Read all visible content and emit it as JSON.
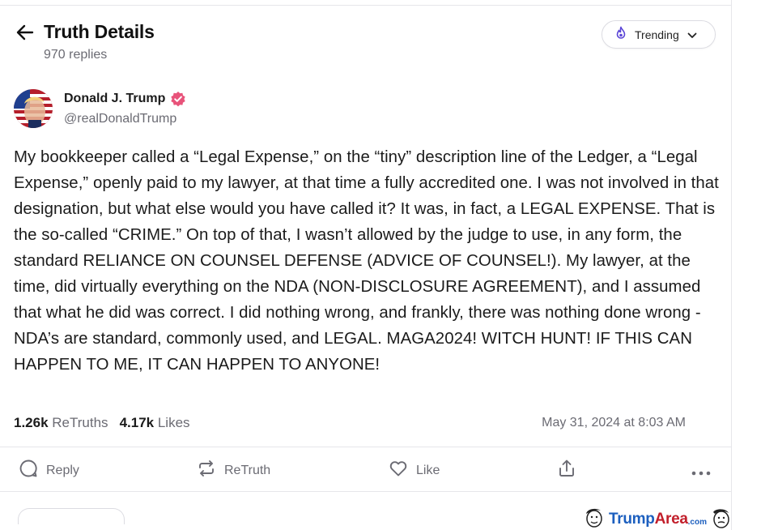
{
  "header": {
    "title": "Truth Details",
    "replies": "970 replies",
    "trending_label": "Trending"
  },
  "author": {
    "name": "Donald J. Trump",
    "handle": "@realDonaldTrump"
  },
  "post": {
    "text": "My bookkeeper called a “Legal Expense,” on the “tiny” description line of the Ledger, a “Legal Expense,” openly paid to my lawyer, at that time a fully accredited one. I was not involved in that designation, but what else would you have called it? It was, in fact, a LEGAL EXPENSE. That is the so-called “CRIME.” On top of that, I wasn’t allowed by the judge to use, in any form, the standard RELIANCE ON COUNSEL DEFENSE (ADVICE OF COUNSEL!). My lawyer, at the time, did virtually everything on the NDA (NON-DISCLOSURE AGREEMENT), and I assumed that what he did was correct. I did nothing wrong, and frankly, there was nothing done wrong - NDA’s are standard, commonly used, and LEGAL. MAGA2024! WITCH HUNT! IF THIS CAN HAPPEN TO ME, IT CAN HAPPEN TO ANYONE!",
    "retruths_count": "1.26k",
    "retruths_label": "ReTruths",
    "likes_count": "4.17k",
    "likes_label": "Likes",
    "timestamp": "May 31, 2024 at 8:03 AM"
  },
  "actions": {
    "reply": "Reply",
    "retruth": "ReTruth",
    "like": "Like"
  },
  "watermark": {
    "trump": "Trump",
    "area": "Area",
    "com": ".com"
  },
  "colors": {
    "verified": "#e8537a",
    "trending_icon": "#5a45d6",
    "watermark_blue": "#1c5fbf",
    "watermark_red": "#c21f2b"
  }
}
